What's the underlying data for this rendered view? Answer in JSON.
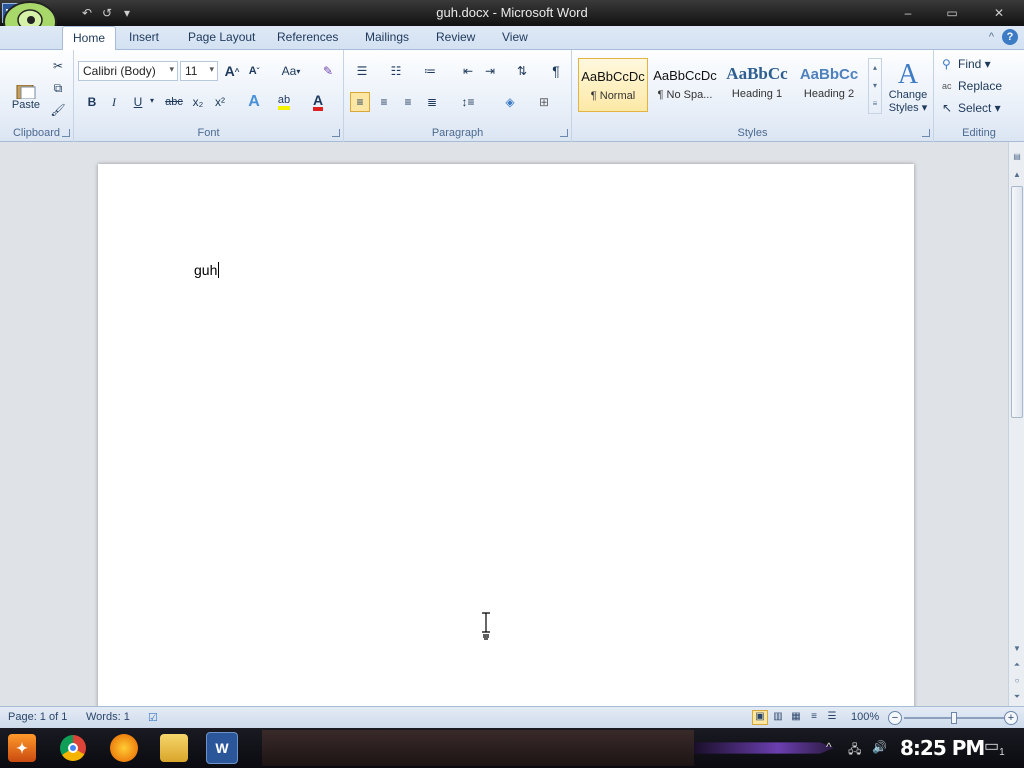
{
  "window": {
    "title": "guh.docx - Microsoft Word",
    "minimize": "–",
    "maximize": "▭",
    "close": "✕"
  },
  "qat": {
    "app_icon": "W",
    "undo": "↶",
    "redo": "↺",
    "more": "▾"
  },
  "tabs": [
    "Home",
    "Insert",
    "Page Layout",
    "References",
    "Mailings",
    "Review",
    "View"
  ],
  "clipboard": {
    "paste": "Paste",
    "label": "Clipboard"
  },
  "font": {
    "name": "Calibri (Body)",
    "size": "11",
    "label": "Font",
    "bold": "B",
    "italic": "I",
    "underline": "U",
    "strike": "abc",
    "subscript": "x₂",
    "superscript": "x²",
    "grow": "A",
    "shrink": "A",
    "change_case": "Aa",
    "color_accent": "#e02020",
    "highlight_accent": "#f5f200"
  },
  "paragraph": {
    "label": "Paragraph",
    "show_marks": "¶"
  },
  "styles": {
    "label": "Styles",
    "items": [
      {
        "preview": "AaBbCcDc",
        "name": "¶ Normal"
      },
      {
        "preview": "AaBbCcDc",
        "name": "¶ No Spa..."
      },
      {
        "preview": "AaBbCc",
        "name": "Heading 1"
      },
      {
        "preview": "AaBbCc",
        "name": "Heading 2"
      }
    ],
    "change_styles_1": "Change",
    "change_styles_2": "Styles ▾"
  },
  "editing": {
    "label": "Editing",
    "find": "Find ▾",
    "replace": "Replace",
    "select": "Select ▾"
  },
  "document": {
    "text": "guh"
  },
  "status": {
    "page": "Page: 1 of 1",
    "words": "Words: 1",
    "zoom": "100%",
    "zoom_level": 1.0
  },
  "taskbar": {
    "clock": "8:25 PM",
    "notifications": "1"
  },
  "help": {
    "minimize_ribbon": "^",
    "help_symbol": "?"
  }
}
